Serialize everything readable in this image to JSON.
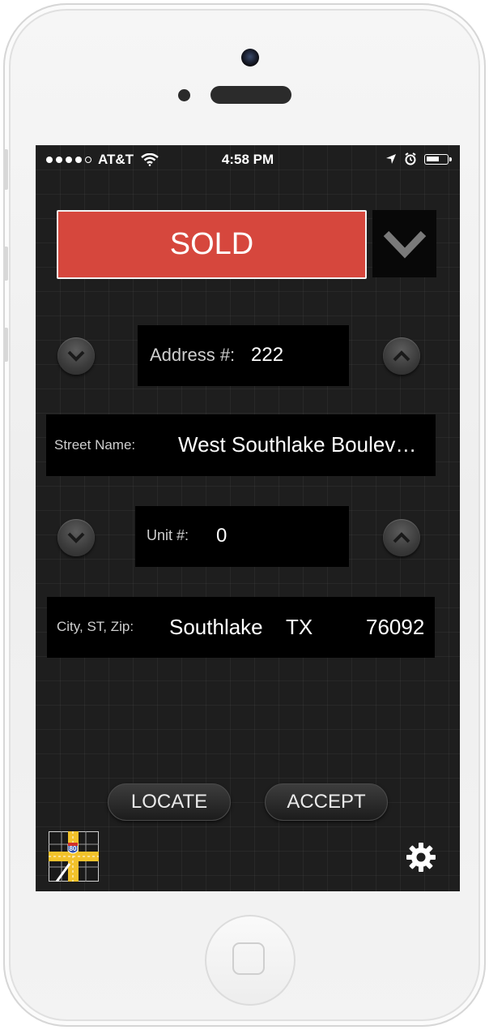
{
  "status_bar": {
    "carrier": "AT&T",
    "time": "4:58 PM",
    "signal_bars_filled": 4,
    "signal_bars_total": 5,
    "icons": [
      "wifi-icon",
      "location-arrow-icon",
      "alarm-icon",
      "battery-icon"
    ]
  },
  "status": {
    "label": "SOLD",
    "color": "#d6473d"
  },
  "address_number": {
    "label": "Address #:",
    "value": "222"
  },
  "street_name": {
    "label": "Street Name:",
    "value": "West Southlake Boulev…"
  },
  "unit_number": {
    "label": "Unit #:",
    "value": "0"
  },
  "city_st_zip": {
    "label": "City, ST, Zip:",
    "city": "Southlake",
    "state": "TX",
    "zip": "76092"
  },
  "actions": {
    "locate_label": "LOCATE",
    "accept_label": "ACCEPT"
  },
  "map_icon_shield": "80",
  "icons": [
    "chevron-down-icon",
    "chevron-up-icon",
    "map-icon",
    "gear-icon"
  ]
}
